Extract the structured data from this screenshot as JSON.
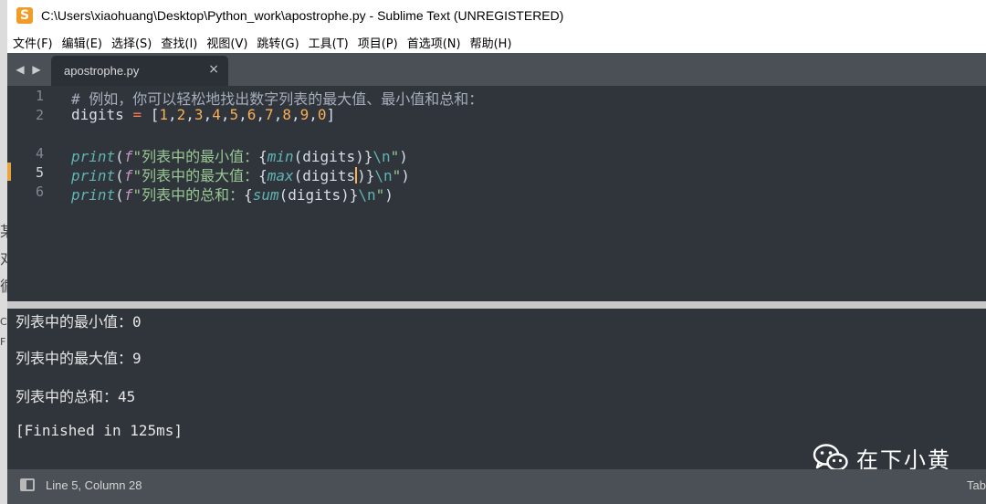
{
  "window": {
    "title": "C:\\Users\\xiaohuang\\Desktop\\Python_work\\apostrophe.py - Sublime Text (UNREGISTERED)",
    "app_icon": "sublime-text-icon",
    "app_icon_glyph": "S"
  },
  "menu": [
    "文件(F)",
    "编辑(E)",
    "选择(S)",
    "查找(I)",
    "视图(V)",
    "跳转(G)",
    "工具(T)",
    "项目(P)",
    "首选项(N)",
    "帮助(H)"
  ],
  "tabs": [
    {
      "label": "apostrophe.py",
      "active": true,
      "close": "×"
    }
  ],
  "nav": {
    "back": "◀",
    "forward": "▶"
  },
  "editor": {
    "line_numbers": [
      "1",
      "2",
      "4",
      "5",
      "6"
    ],
    "active_line": "5",
    "lines": {
      "l1": "# 例如，你可以轻松地找出数字列表的最大值、最小值和总和：",
      "l2": {
        "var": "digits",
        "op": "=",
        "open": "[",
        "nums": [
          "1",
          "2",
          "3",
          "4",
          "5",
          "6",
          "7",
          "8",
          "9",
          "0"
        ],
        "comma": ",",
        "close": "]"
      },
      "l4": {
        "fn": "print",
        "prefix": "f",
        "str": "\"列表中的最小值：",
        "inner_fn": "min",
        "arg": "digits",
        "esc": "\\n",
        "end": "\""
      },
      "l5": {
        "fn": "print",
        "prefix": "f",
        "str": "\"列表中的最大值：",
        "inner_fn": "max",
        "arg": "digits",
        "esc": "\\n",
        "end": "\""
      },
      "l6": {
        "fn": "print",
        "prefix": "f",
        "str": "\"列表中的总和：",
        "inner_fn": "sum",
        "arg": "digits",
        "esc": "\\n",
        "end": "\""
      }
    }
  },
  "output": {
    "lines": [
      "列表中的最小值：0",
      "列表中的最大值：9",
      "列表中的总和：45",
      "[Finished in 125ms]"
    ]
  },
  "watermark": {
    "text": "在下小黄",
    "icon": "wechat-icon"
  },
  "statusbar": {
    "position": "Line 5, Column 28",
    "indent": "Tab"
  },
  "background": {
    "chars": [
      "某",
      "对",
      "循",
      "C:",
      "F"
    ]
  },
  "colors": {
    "editor_bg": "#2f353b",
    "tabbar_bg": "#4a5055",
    "comment": "#a7adba",
    "operator": "#f97b58",
    "number": "#f9ae58",
    "function": "#5fb4b4",
    "string": "#99c794",
    "prefix": "#c594c5"
  }
}
